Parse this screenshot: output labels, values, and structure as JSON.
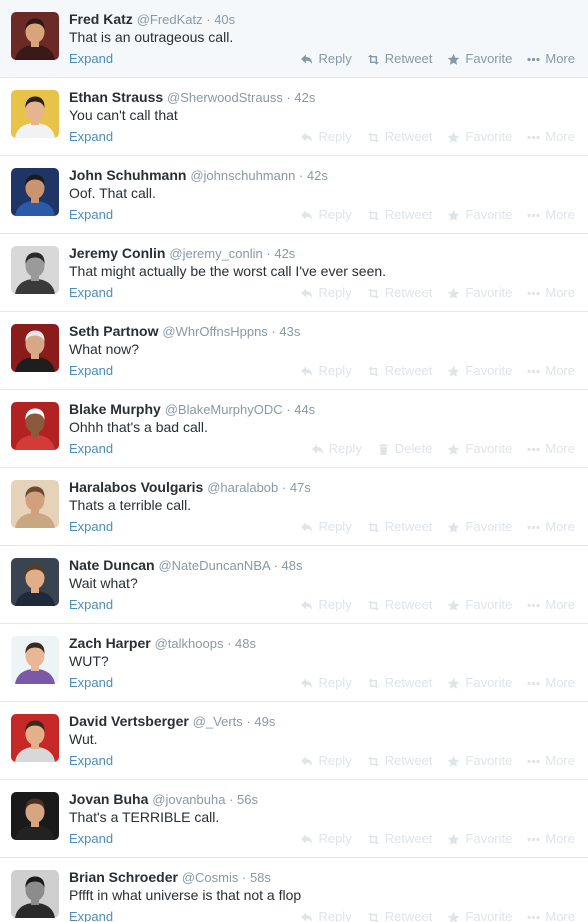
{
  "colors": {
    "name": "#292f33",
    "meta": "#8899a6",
    "link": "#4a8db8",
    "action_faded": "#dfe4e8",
    "action_active": "#8899a6",
    "row_hover": "#f5f8fa",
    "divider": "#e8e8e8"
  },
  "tweets": [
    {
      "name": "Fred Katz",
      "handle": "@FredKatz",
      "time": "40s",
      "text": "That is an outrageous call.",
      "expand": "Expand",
      "actions": [
        "Reply",
        "Retweet",
        "Favorite",
        "More"
      ],
      "action_icons": [
        "reply-icon",
        "retweet-icon",
        "favorite-star-icon",
        "more-dots-icon"
      ],
      "hovered": true,
      "avatar": {
        "bg": "#6b2a26",
        "skin": "#d9a47c",
        "hair": "#2b1a12",
        "shirt": "#3a1a18"
      }
    },
    {
      "name": "Ethan Strauss",
      "handle": "@SherwoodStrauss",
      "time": "42s",
      "text": "You can't call that",
      "expand": "Expand",
      "actions": [
        "Reply",
        "Retweet",
        "Favorite",
        "More"
      ],
      "action_icons": [
        "reply-icon",
        "retweet-icon",
        "favorite-star-icon",
        "more-dots-icon"
      ],
      "hovered": false,
      "avatar": {
        "bg": "#e8c34a",
        "skin": "#e4b58e",
        "hair": "#2c2018",
        "shirt": "#f2f2f2"
      }
    },
    {
      "name": "John Schuhmann",
      "handle": "@johnschuhmann",
      "time": "42s",
      "text": "Oof. That call.",
      "expand": "Expand",
      "actions": [
        "Reply",
        "Retweet",
        "Favorite",
        "More"
      ],
      "action_icons": [
        "reply-icon",
        "retweet-icon",
        "favorite-star-icon",
        "more-dots-icon"
      ],
      "hovered": false,
      "avatar": {
        "bg": "#1f3566",
        "skin": "#c99470",
        "hair": "#1a1a1a",
        "shirt": "#2b5aa8"
      }
    },
    {
      "name": "Jeremy Conlin",
      "handle": "@jeremy_conlin",
      "time": "42s",
      "text": "That might actually be the worst call I've ever seen.",
      "expand": "Expand",
      "actions": [
        "Reply",
        "Retweet",
        "Favorite",
        "More"
      ],
      "action_icons": [
        "reply-icon",
        "retweet-icon",
        "favorite-star-icon",
        "more-dots-icon"
      ],
      "hovered": false,
      "avatar": {
        "bg": "#d8d8d8",
        "skin": "#9a9a9a",
        "hair": "#2a2a2a",
        "shirt": "#3a3a3a"
      }
    },
    {
      "name": "Seth Partnow",
      "handle": "@WhrOffnsHppns",
      "time": "43s",
      "text": "What now?",
      "expand": "Expand",
      "actions": [
        "Reply",
        "Retweet",
        "Favorite",
        "More"
      ],
      "action_icons": [
        "reply-icon",
        "retweet-icon",
        "favorite-star-icon",
        "more-dots-icon"
      ],
      "hovered": false,
      "avatar": {
        "bg": "#8a1c1c",
        "skin": "#d6a888",
        "hair": "#e8e8e8",
        "shirt": "#1e1e1e"
      }
    },
    {
      "name": "Blake Murphy",
      "handle": "@BlakeMurphyODC",
      "time": "44s",
      "text": "Ohhh that's a bad call.",
      "expand": "Expand",
      "actions": [
        "Reply",
        "Delete",
        "Favorite",
        "More"
      ],
      "action_icons": [
        "reply-icon",
        "delete-trash-icon",
        "favorite-star-icon",
        "more-dots-icon"
      ],
      "hovered": false,
      "avatar": {
        "bg": "#b32222",
        "skin": "#8a5a3c",
        "hair": "#ffffff",
        "shirt": "#d43a3a"
      }
    },
    {
      "name": "Haralabos Voulgaris",
      "handle": "@haralabob",
      "time": "47s",
      "text": "Thats a terrible call.",
      "expand": "Expand",
      "actions": [
        "Reply",
        "Retweet",
        "Favorite",
        "More"
      ],
      "action_icons": [
        "reply-icon",
        "retweet-icon",
        "favorite-star-icon",
        "more-dots-icon"
      ],
      "hovered": false,
      "avatar": {
        "bg": "#e6d2b8",
        "skin": "#d2a07c",
        "hair": "#6b4a30",
        "shirt": "#c8a882"
      }
    },
    {
      "name": "Nate Duncan",
      "handle": "@NateDuncanNBA",
      "time": "48s",
      "text": "Wait what?",
      "expand": "Expand",
      "actions": [
        "Reply",
        "Retweet",
        "Favorite",
        "More"
      ],
      "action_icons": [
        "reply-icon",
        "retweet-icon",
        "favorite-star-icon",
        "more-dots-icon"
      ],
      "hovered": false,
      "avatar": {
        "bg": "#3a4450",
        "skin": "#e0ae88",
        "hair": "#5a3a22",
        "shirt": "#1e2a3a"
      }
    },
    {
      "name": "Zach Harper",
      "handle": "@talkhoops",
      "time": "48s",
      "text": "WUT?",
      "expand": "Expand",
      "actions": [
        "Reply",
        "Retweet",
        "Favorite",
        "More"
      ],
      "action_icons": [
        "reply-icon",
        "retweet-icon",
        "favorite-star-icon",
        "more-dots-icon"
      ],
      "hovered": false,
      "avatar": {
        "bg": "#eef3f6",
        "skin": "#e8b896",
        "hair": "#3a2a1e",
        "shirt": "#7a5aa8"
      }
    },
    {
      "name": "David Vertsberger",
      "handle": "@_Verts",
      "time": "49s",
      "text": "Wut.",
      "expand": "Expand",
      "actions": [
        "Reply",
        "Retweet",
        "Favorite",
        "More"
      ],
      "action_icons": [
        "reply-icon",
        "retweet-icon",
        "favorite-star-icon",
        "more-dots-icon"
      ],
      "hovered": false,
      "avatar": {
        "bg": "#c62828",
        "skin": "#e4b08a",
        "hair": "#3a2a1c",
        "shirt": "#d8d8d8"
      }
    },
    {
      "name": "Jovan Buha",
      "handle": "@jovanbuha",
      "time": "56s",
      "text": "That's a TERRIBLE call.",
      "expand": "Expand",
      "actions": [
        "Reply",
        "Retweet",
        "Favorite",
        "More"
      ],
      "action_icons": [
        "reply-icon",
        "retweet-icon",
        "favorite-star-icon",
        "more-dots-icon"
      ],
      "hovered": false,
      "avatar": {
        "bg": "#1a1a1a",
        "skin": "#d8a580",
        "hair": "#4a3020",
        "shirt": "#222222"
      }
    },
    {
      "name": "Brian Schroeder",
      "handle": "@Cosmis",
      "time": "58s",
      "text": "Pffft in what universe is that not a flop",
      "expand": "Expand",
      "actions": [
        "Reply",
        "Retweet",
        "Favorite",
        "More"
      ],
      "action_icons": [
        "reply-icon",
        "retweet-icon",
        "favorite-star-icon",
        "more-dots-icon"
      ],
      "hovered": false,
      "avatar": {
        "bg": "#cfcfcf",
        "skin": "#8c8c8c",
        "hair": "#1a1a1a",
        "shirt": "#2a2a2a"
      }
    }
  ]
}
